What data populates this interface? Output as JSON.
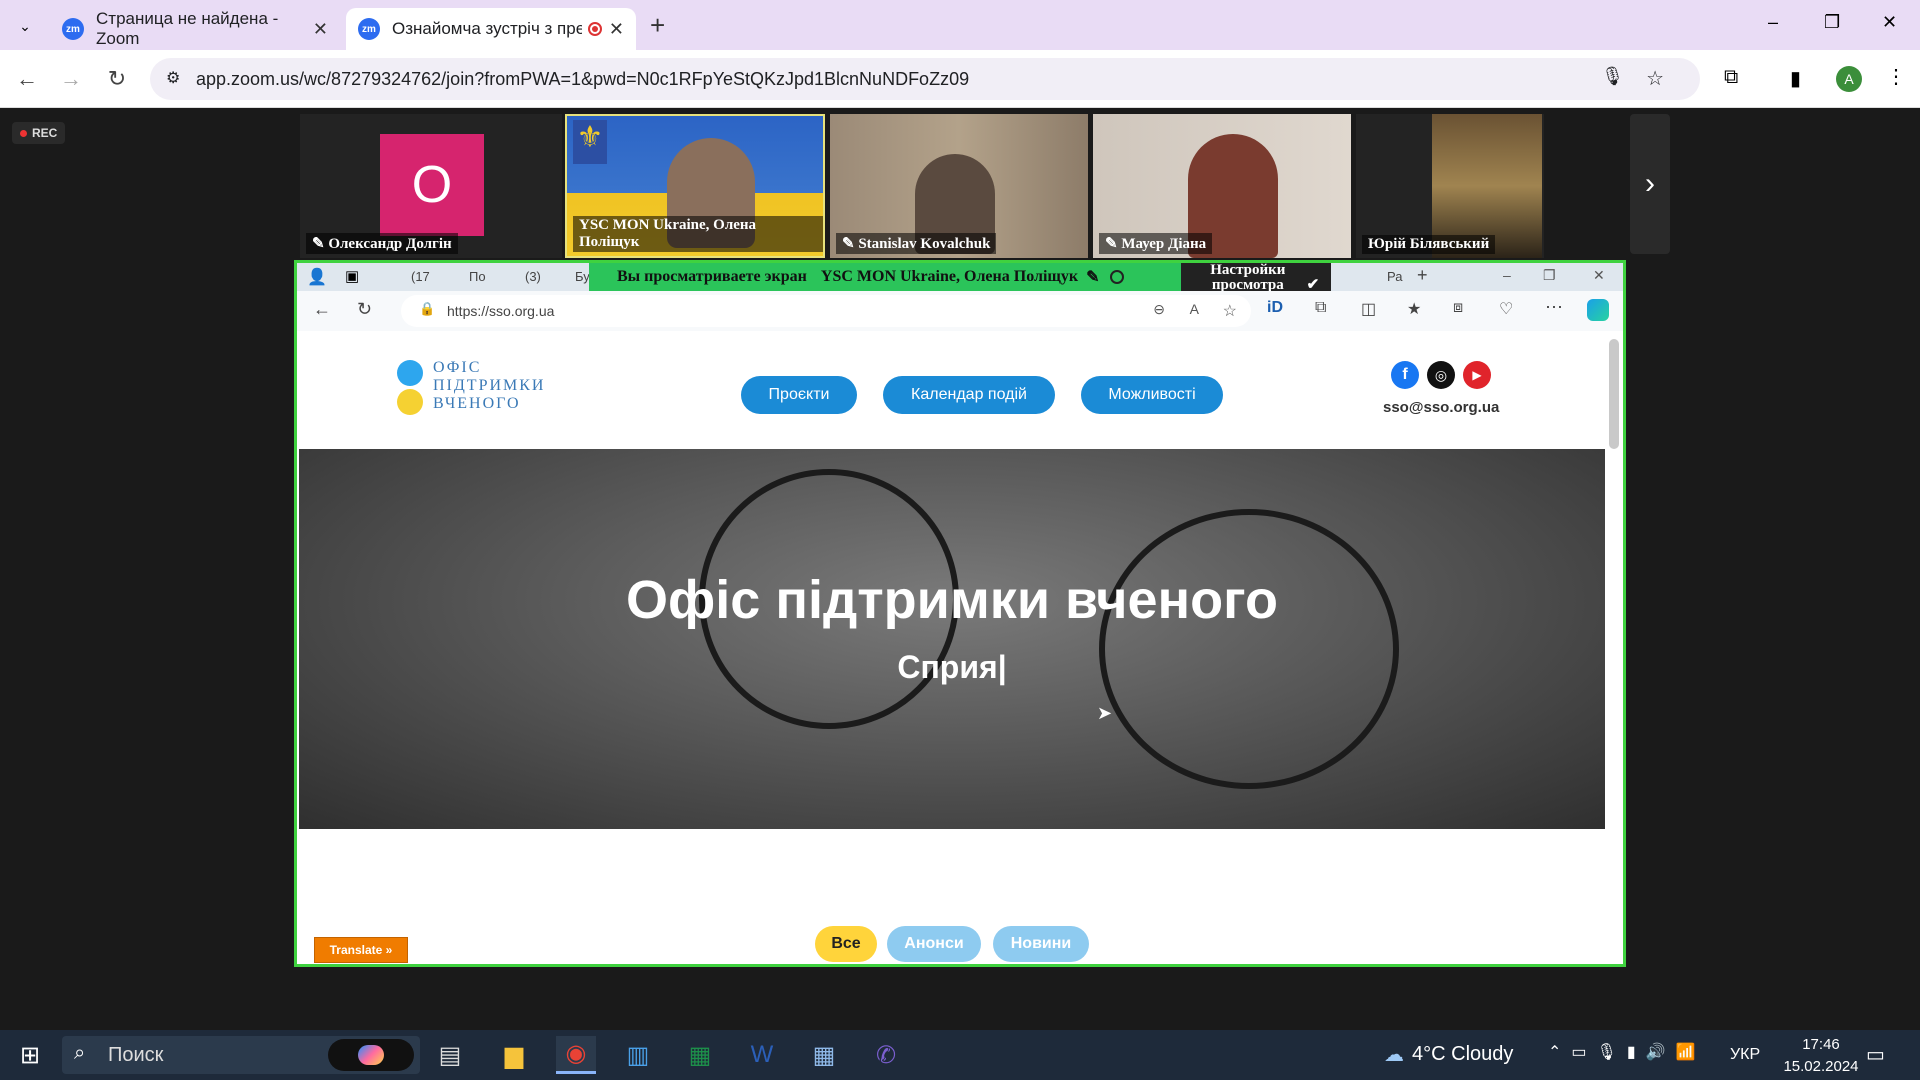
{
  "chrome": {
    "tabs": [
      {
        "title": "Страница не найдена - Zoom",
        "icon": "zm"
      },
      {
        "title": "Ознайомча зустріч з пред",
        "icon": "zm"
      }
    ],
    "new_tab": "+",
    "url": "app.zoom.us/wc/87279324762/join?fromPWA=1&pwd=N0c1RFpYeStQKzJpd1BlcnNuNDFoZz09",
    "profile_initial": "A",
    "window_controls": [
      "–",
      "❐",
      "✕"
    ]
  },
  "zoom": {
    "rec_label": "REC",
    "participants": [
      {
        "name": "Олександр Долгін",
        "avatar_letter": "O",
        "avatar_color": "#d6246e"
      },
      {
        "name": "YSC MON Ukraine, Олена Поліщук"
      },
      {
        "name": "Stanislav Kovalchuk"
      },
      {
        "name": "Мауер Діана"
      },
      {
        "name": "Юрій Білявський"
      }
    ],
    "banner_text": "Вы просматриваете экран",
    "presenter": "YSC MON Ukraine, Олена Поліщук",
    "view_options": "Настройки просмотра"
  },
  "shared": {
    "edge_tabs": [
      "(17",
      "По",
      "(3)",
      "Бу",
      "Ра"
    ],
    "url": "https://sso.org.ua",
    "logo_lines": [
      "ОФІС",
      "ПІДТРИМКИ",
      "ВЧЕНОГО"
    ],
    "nav": [
      "Проєкти",
      "Календар подій",
      "Можливості"
    ],
    "email": "sso@sso.org.ua",
    "hero_title": "Офіс підтримки вченого",
    "hero_sub": "Сприя|",
    "filters": [
      "Все",
      "Анонси",
      "Новини"
    ],
    "translate": "Translate »"
  },
  "taskbar": {
    "search": "Поиск",
    "weather": "4°C Cloudy",
    "lang": "УКР",
    "time": "17:46",
    "date": "15.02.2024"
  },
  "colors": {
    "zoom_border": "#3fd23f",
    "pill_blue": "#1b8bd6",
    "filter_active": "#ffd43b",
    "filter_light": "#8ecbf0"
  }
}
